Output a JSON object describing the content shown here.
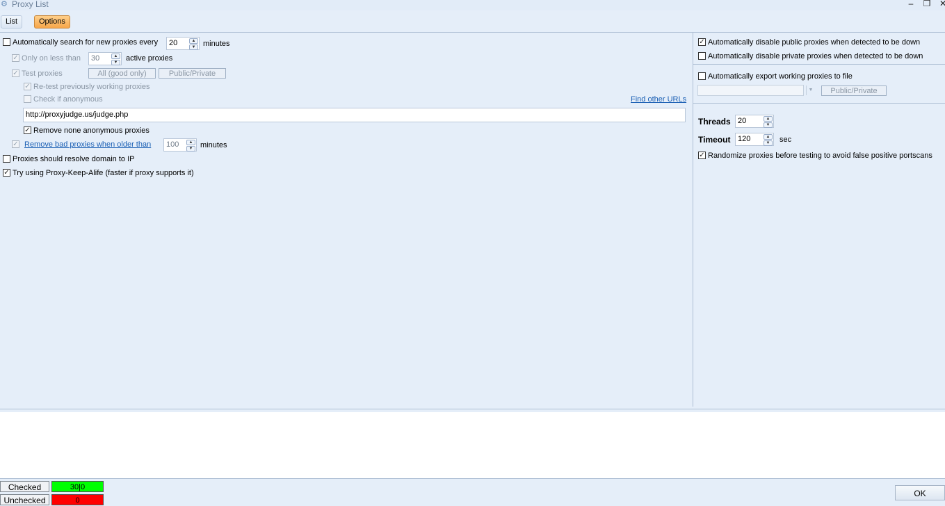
{
  "window": {
    "title": "Proxy List",
    "title_icon": "proxy-app-icon",
    "controls": {
      "minimize": "–",
      "maximize": "❐",
      "close": "✕"
    }
  },
  "tabs": [
    {
      "label": "List",
      "active": false
    },
    {
      "label": "Options",
      "active": true
    }
  ],
  "left": {
    "auto_search": {
      "label": "Automatically search for new proxies every",
      "checked": false,
      "value": "20",
      "unit": "minutes"
    },
    "only_less_than": {
      "label": "Only on less than",
      "checked": true,
      "disabled": true,
      "value": "30",
      "unit": "active proxies"
    },
    "test_proxies": {
      "label": "Test proxies",
      "checked": true,
      "disabled": true,
      "btn_all": "All (good only)",
      "btn_public_private": "Public/Private"
    },
    "retest": {
      "label": "Re-test previously working proxies",
      "checked": true,
      "disabled": true
    },
    "check_anon": {
      "label": "Check if anonymous",
      "checked": false,
      "disabled": true
    },
    "find_other_urls": "Find other URLs",
    "judge_url": "http://proxyjudge.us/judge.php",
    "remove_non_anon": {
      "label": "Remove none anonymous proxies",
      "checked": true
    },
    "remove_bad": {
      "label": "Remove bad proxies when older than",
      "checked": true,
      "disabled": true,
      "value": "100",
      "unit": "minutes"
    },
    "resolve_domain": {
      "label": "Proxies should resolve domain to IP",
      "checked": false
    },
    "keep_alive": {
      "label": "Try using Proxy-Keep-Alife (faster if proxy supports it)",
      "checked": true
    }
  },
  "right": {
    "disable_public": {
      "label": "Automatically disable public proxies when detected to be down",
      "checked": true
    },
    "disable_private": {
      "label": "Automatically disable private proxies when detected to be down",
      "checked": false
    },
    "export": {
      "label": "Automatically export working proxies to file",
      "checked": false,
      "file_value": "",
      "btn_public_private": "Public/Private"
    },
    "threads": {
      "label": "Threads",
      "value": "20"
    },
    "timeout": {
      "label": "Timeout",
      "value": "120",
      "unit": "sec"
    },
    "randomize": {
      "label": "Randomize proxies before testing to avoid false positive portscans",
      "checked": true
    }
  },
  "status": {
    "checked_label": "Checked",
    "checked_count": "30|0",
    "checked_color": "#00ff00",
    "unchecked_label": "Unchecked",
    "unchecked_count": "0",
    "unchecked_color": "#ff0000",
    "ok_label": "OK"
  }
}
